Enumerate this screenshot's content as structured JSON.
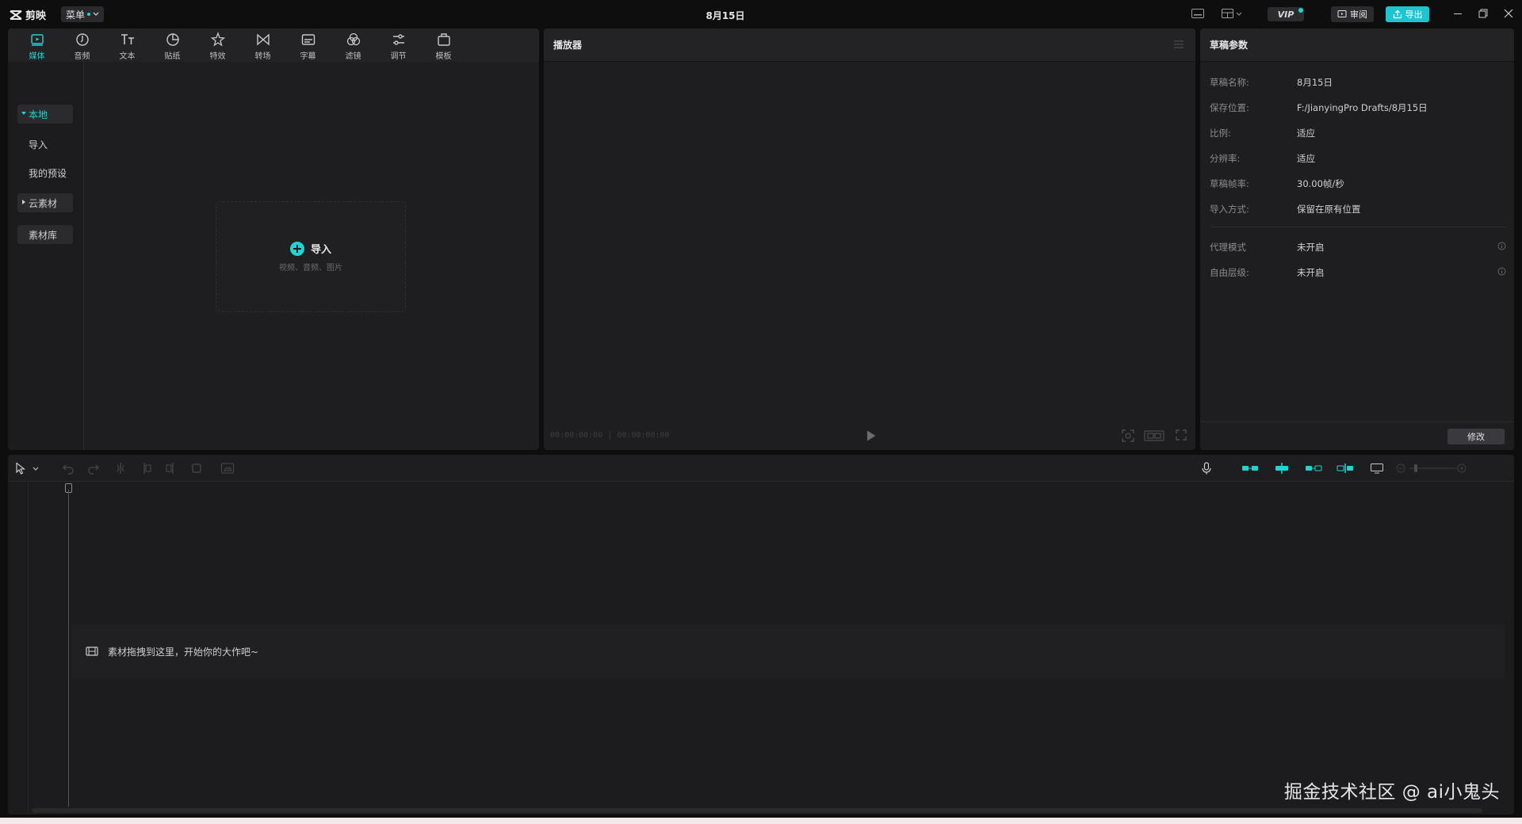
{
  "app": {
    "name": "剪映",
    "menu_label": "菜单",
    "window_title": "8月15日",
    "vip_label": "VIP",
    "review_label": "审阅",
    "export_label": "导出",
    "accent_color": "#22d3d3"
  },
  "media": {
    "tabs": [
      {
        "label": "媒体",
        "icon": "media-icon",
        "active": true
      },
      {
        "label": "音频",
        "icon": "audio-icon"
      },
      {
        "label": "文本",
        "icon": "text-icon"
      },
      {
        "label": "贴纸",
        "icon": "sticker-icon"
      },
      {
        "label": "特效",
        "icon": "effects-icon"
      },
      {
        "label": "转场",
        "icon": "transition-icon"
      },
      {
        "label": "字幕",
        "icon": "subtitle-icon"
      },
      {
        "label": "滤镜",
        "icon": "filter-icon"
      },
      {
        "label": "调节",
        "icon": "adjust-icon"
      },
      {
        "label": "模板",
        "icon": "template-icon"
      }
    ],
    "sidebar": {
      "local": "本地",
      "import": "导入",
      "presets": "我的预设",
      "cloud": "云素材",
      "library": "素材库"
    },
    "import_box": {
      "label": "导入",
      "hint": "视频、音频、图片"
    }
  },
  "player": {
    "title": "播放器",
    "current_time": "00:00:00:00",
    "total_time": "00:00:00:00"
  },
  "params": {
    "title": "草稿参数",
    "rows": [
      {
        "key": "草稿名称:",
        "value": "8月15日"
      },
      {
        "key": "保存位置:",
        "value": "F:/JianyingPro Drafts/8月15日"
      },
      {
        "key": "比例:",
        "value": "适应"
      },
      {
        "key": "分辨率:",
        "value": "适应"
      },
      {
        "key": "草稿帧率:",
        "value": "30.00帧/秒"
      },
      {
        "key": "导入方式:",
        "value": "保留在原有位置"
      }
    ],
    "extra_rows": [
      {
        "key": "代理模式",
        "value": "未开启"
      },
      {
        "key": "自由层级:",
        "value": "未开启"
      }
    ],
    "modify_label": "修改"
  },
  "timeline": {
    "drop_hint": "素材拖拽到这里，开始你的大作吧~"
  },
  "watermark": "掘金技术社区 @ ai小鬼头"
}
